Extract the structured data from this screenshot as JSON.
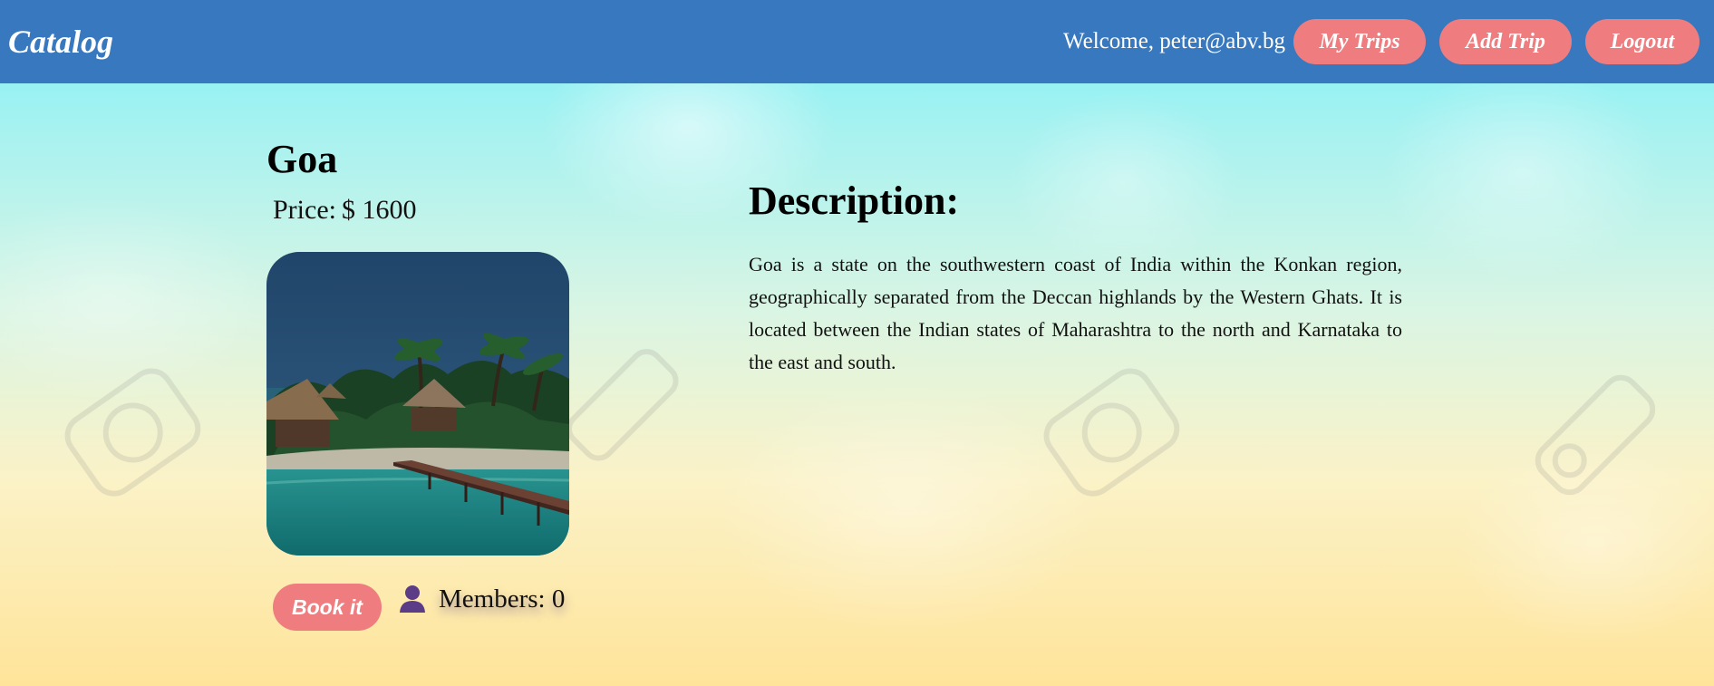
{
  "header": {
    "logo": "Catalog",
    "welcome": "Welcome, peter@abv.bg",
    "nav": {
      "my_trips": "My Trips",
      "add_trip": "Add Trip",
      "logout": "Logout"
    }
  },
  "trip": {
    "name": "Goa",
    "price_label": "Price:",
    "price_value": "$ 1600",
    "image_alt": "Tropical beach resort with thatched huts, palm trees and a wooden pier over turquoise water"
  },
  "actions": {
    "book_label": "Book it",
    "members_text": "Members: 0"
  },
  "description": {
    "heading": "Description:",
    "text": "Goa is a state on the southwestern coast of India within the Konkan region, geographically separated from the Deccan highlands by the Western Ghats. It is located between the Indian states of Maharashtra to the north and Karnataka to the east and south."
  },
  "colors": {
    "header_bg": "#3778bf",
    "button_bg": "#ef7d7f",
    "member_icon": "#5a3d86"
  },
  "icons": {
    "members": "user-icon"
  }
}
